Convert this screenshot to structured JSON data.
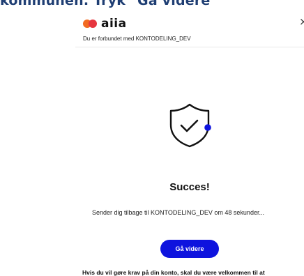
{
  "document": {
    "heading_fragment": "kommunen. Tryk \"Gå videre\""
  },
  "dialog": {
    "brand": "aiia",
    "connected_text": "Du er forbundet med KONTODELING_DEV",
    "close_label": "×",
    "status_icon": "shield-check-icon",
    "title": "Succes!",
    "redirect_text": "Sender dig tilbage til KONTODELING_DEV om 48 sekunder...",
    "continue_button": "Gå videre",
    "footer_text": "Hvis du vil gøre krav på din konto, skal du være velkommen til at"
  },
  "colors": {
    "brand_orange": "#f26a21",
    "brand_red": "#e6363f",
    "accent_blue": "#0e13de",
    "heading_blue": "#1f3e73"
  }
}
